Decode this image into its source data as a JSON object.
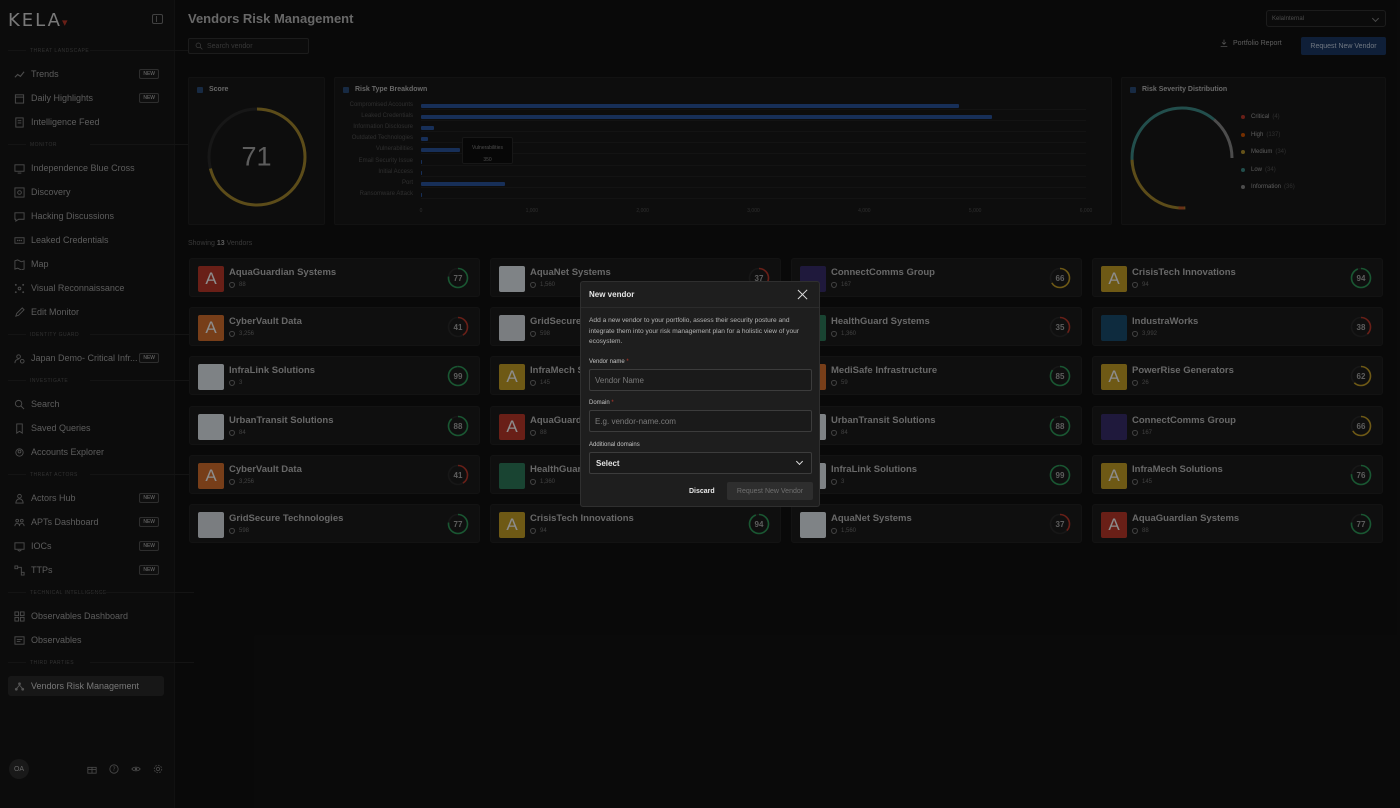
{
  "sidebar": {
    "logo": "KELA",
    "sections": {
      "threat_landscape": "Threat Landscape",
      "monitor": "Monitor",
      "identity_guard": "Identity Guard",
      "investigate": "Investigate",
      "threat_actors": "Threat Actors",
      "technical_intelligence": "Technical Intelligence",
      "third_parties": "Third Parties"
    },
    "items": {
      "trends": "Trends",
      "daily_highlights": "Daily Highlights",
      "intelligence_feed": "Intelligence Feed",
      "independence": "Independence Blue Cross",
      "discovery": "Discovery",
      "hacking_discussions": "Hacking Discussions",
      "leaked_credentials": "Leaked Credentials",
      "map": "Map",
      "visual_recon": "Visual Reconnaissance",
      "edit_monitor": "Edit Monitor",
      "japan_demo": "Japan Demo- Critical Infr...",
      "search": "Search",
      "saved_queries": "Saved Queries",
      "accounts_explorer": "Accounts Explorer",
      "actors_hub": "Actors Hub",
      "apts_dashboard": "APTs Dashboard",
      "iocs": "IOCs",
      "ttps": "TTPs",
      "observables_dashboard": "Observables Dashboard",
      "observables": "Observables",
      "vendors_risk": "Vendors Risk Management"
    },
    "new_badge": "NEW",
    "avatar": "OA"
  },
  "header": {
    "title": "Vendors Risk Management",
    "tenant": "KelaInternal",
    "search_placeholder": "Search vendor",
    "portfolio_report": "Portfolio Report",
    "request_new_vendor": "Request New Vendor"
  },
  "score_card": {
    "title": "Score",
    "value": "71",
    "score": 71
  },
  "risk_type": {
    "title": "Risk Type Breakdown",
    "tooltip_label": "Vulnerabilities",
    "tooltip_value": "350"
  },
  "chart_data": {
    "type": "bar",
    "orientation": "horizontal",
    "title": "Risk Type Breakdown",
    "categories": [
      "Compromised Accounts",
      "Leaked Credentials",
      "Information Disclosure",
      "Outdated Technologies",
      "Vulnerabilities",
      "Email Security Issue",
      "Initial Access",
      "Port",
      "Ransomware Attack"
    ],
    "values": [
      4850,
      5150,
      120,
      60,
      350,
      10,
      5,
      760,
      0
    ],
    "x_ticks": [
      "0",
      "1,000",
      "2,000",
      "3,000",
      "4,000",
      "5,000",
      "6,000"
    ],
    "xlim": [
      0,
      6000
    ]
  },
  "severity": {
    "title": "Risk Severity Distribution",
    "legend": [
      {
        "label": "Critical",
        "count": "(4)",
        "color": "#c0392b"
      },
      {
        "label": "High",
        "count": "(137)",
        "color": "#d35400"
      },
      {
        "label": "Medium",
        "count": "(34)",
        "color": "#b8962e"
      },
      {
        "label": "Low",
        "count": "(34)",
        "color": "#3f8f8a"
      },
      {
        "label": "Information",
        "count": "(36)",
        "color": "#8a8a8a"
      }
    ]
  },
  "showing": {
    "prefix": "Showing",
    "count": "13",
    "suffix": "Vendors"
  },
  "vendors": [
    {
      "name": "AquaGuardian Systems",
      "count": "88",
      "score": "77",
      "logo": "A",
      "logo_color": "#c0392b"
    },
    {
      "name": "AquaNet Systems",
      "count": "1,560",
      "score": "37",
      "logo": "",
      "logo_color": "#e8eef5"
    },
    {
      "name": "ConnectComms Group",
      "count": "167",
      "score": "66",
      "logo": "",
      "logo_color": "#3a2e6e"
    },
    {
      "name": "CrisisTech Innovations",
      "count": "94",
      "score": "94",
      "logo": "A",
      "logo_color": "#c9a227"
    },
    {
      "name": "CyberVault Data",
      "count": "3,256",
      "score": "41",
      "logo": "A",
      "logo_color": "#d9722e"
    },
    {
      "name": "GridSecure Technologies",
      "count": "598",
      "score": "77",
      "logo": "",
      "logo_color": "#dfe4ea"
    },
    {
      "name": "HealthGuard Systems",
      "count": "1,360",
      "score": "35",
      "logo": "",
      "logo_color": "#2f7d5b"
    },
    {
      "name": "IndustraWorks",
      "count": "3,992",
      "score": "38",
      "logo": "",
      "logo_color": "#1b4f72"
    },
    {
      "name": "InfraLink Solutions",
      "count": "3",
      "score": "99",
      "logo": "",
      "logo_color": "#e6edf3"
    },
    {
      "name": "InfraMech Solutions",
      "count": "145",
      "score": "76",
      "logo": "A",
      "logo_color": "#c9a227"
    },
    {
      "name": "MediSafe Infrastructure",
      "count": "59",
      "score": "85",
      "logo": "A",
      "logo_color": "#d9722e"
    },
    {
      "name": "PowerRise Generators",
      "count": "26",
      "score": "62",
      "logo": "A",
      "logo_color": "#c9a227"
    },
    {
      "name": "UrbanTransit Solutions",
      "count": "84",
      "score": "88",
      "logo": "",
      "logo_color": "#e6edf3"
    },
    {
      "name": "AquaGuardian Systems",
      "count": "88",
      "score": "77",
      "logo": "A",
      "logo_color": "#c0392b"
    },
    {
      "name": "UrbanTransit Solutions",
      "count": "84",
      "score": "88",
      "logo": "",
      "logo_color": "#e6edf3"
    },
    {
      "name": "ConnectComms Group",
      "count": "167",
      "score": "66",
      "logo": "",
      "logo_color": "#3a2e6e"
    },
    {
      "name": "CyberVault Data",
      "count": "3,256",
      "score": "41",
      "logo": "A",
      "logo_color": "#d9722e"
    },
    {
      "name": "HealthGuard Systems",
      "count": "1,360",
      "score": "35",
      "logo": "",
      "logo_color": "#2f7d5b"
    },
    {
      "name": "InfraLink Solutions",
      "count": "3",
      "score": "99",
      "logo": "",
      "logo_color": "#e6edf3"
    },
    {
      "name": "InfraMech Solutions",
      "count": "145",
      "score": "76",
      "logo": "A",
      "logo_color": "#c9a227"
    },
    {
      "name": "GridSecure Technologies",
      "count": "598",
      "score": "77",
      "logo": "",
      "logo_color": "#dfe4ea"
    },
    {
      "name": "CrisisTech Innovations",
      "count": "94",
      "score": "94",
      "logo": "A",
      "logo_color": "#c9a227"
    },
    {
      "name": "AquaNet Systems",
      "count": "1,560",
      "score": "37",
      "logo": "",
      "logo_color": "#e8eef5"
    },
    {
      "name": "AquaGuardian Systems",
      "count": "88",
      "score": "77",
      "logo": "A",
      "logo_color": "#c0392b"
    }
  ],
  "modal": {
    "title": "New vendor",
    "description": "Add a new vendor to your portfolio, assess their security posture and integrate them into your risk management plan for a holistic view of your ecosystem.",
    "vendor_name_label": "Vendor name",
    "vendor_name_placeholder": "Vendor Name",
    "domain_label": "Domain",
    "domain_placeholder": "E.g. vendor-name.com",
    "additional_domains_label": "Additional domains",
    "additional_domains_value": "Select",
    "required_mark": "*",
    "discard": "Discard",
    "request": "Request New Vendor"
  }
}
